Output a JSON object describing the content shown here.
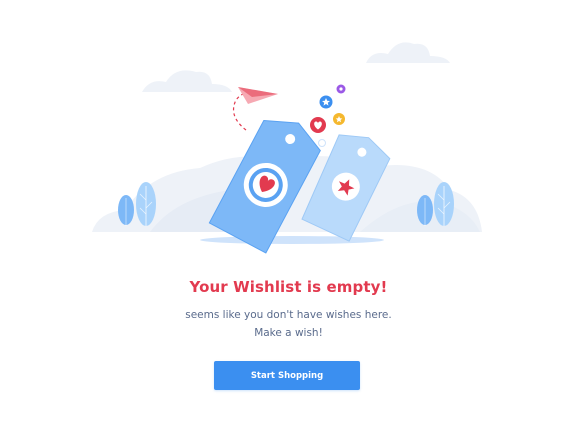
{
  "empty_state": {
    "title": "Your Wishlist is empty!",
    "message_line_1": "seems like you don't have wishes here.",
    "message_line_2": "Make a wish!",
    "button_label": "Start Shopping"
  },
  "colors": {
    "title": "#e23a4f",
    "message": "#5a6b8c",
    "button": "#3b8ff0",
    "tag_front": "#7db8f7",
    "tag_back": "#b9dafb",
    "heart": "#e23a4f"
  },
  "icons": [
    "paper-plane-icon",
    "price-tag-icon",
    "heart-icon",
    "star-icon",
    "cloud-icon",
    "tree-icon"
  ]
}
